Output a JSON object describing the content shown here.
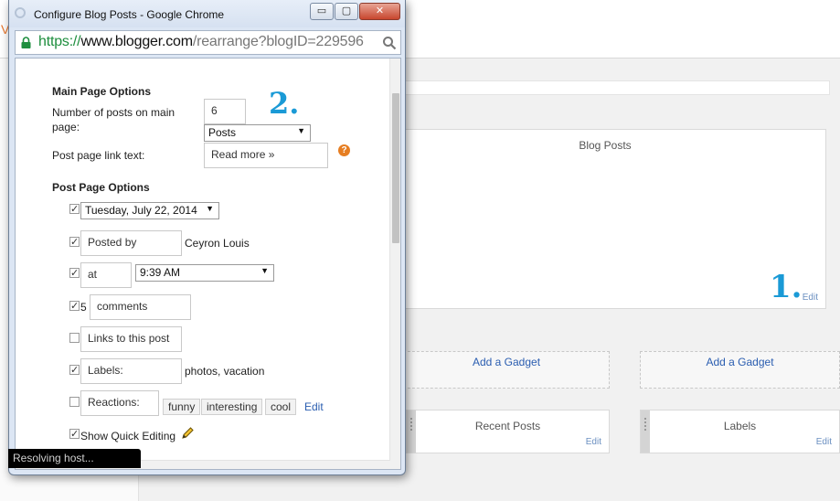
{
  "background": {
    "blog_posts_gadget": {
      "title": "Blog Posts",
      "edit": "Edit",
      "marker": "1."
    },
    "add_gadget_left": "Add a Gadget",
    "add_gadget_right": "Add a Gadget",
    "recent_posts_gadget": {
      "title": "Recent Posts",
      "edit": "Edit"
    },
    "labels_gadget": {
      "title": "Labels",
      "edit": "Edit"
    }
  },
  "window": {
    "title": "Configure Blog Posts - Google Chrome",
    "controls": {
      "minimize": "▭",
      "maximize": "▢",
      "close": "✕"
    },
    "url": {
      "scheme": "https://",
      "host": "www.blogger.com",
      "path": "/rearrange?blogID=229596"
    },
    "status": "Resolving host..."
  },
  "form": {
    "marker": "2.",
    "main_page": {
      "heading": "Main Page Options",
      "posts_label": "Number of posts on main page:",
      "posts_value": "6",
      "posts_unit": "Posts",
      "link_text_label": "Post page link text:",
      "link_text_value": "Read more »",
      "help": "?"
    },
    "post_page": {
      "heading": "Post Page Options",
      "date_option": {
        "checked": true,
        "value": "Tuesday, July 22, 2014"
      },
      "posted_by": {
        "checked": true,
        "field": "Posted by",
        "value": "Ceyron Louis"
      },
      "time": {
        "checked": true,
        "field": "at",
        "value": "9:39 AM"
      },
      "comments": {
        "checked": true,
        "count": "5",
        "field": "comments"
      },
      "links": {
        "checked": false,
        "field": "Links to this post"
      },
      "labels": {
        "checked": true,
        "field": "Labels:",
        "value": "photos, vacation"
      },
      "reactions": {
        "checked": false,
        "field": "Reactions:",
        "tags": [
          "funny",
          "interesting",
          "cool"
        ],
        "edit": "Edit"
      },
      "quick_edit": {
        "checked": true,
        "label": "Show Quick Editing"
      }
    }
  },
  "colors": {
    "accent_marker": "#1a9ad6",
    "link": "#2a5db0",
    "help_icon": "#e67e22",
    "url_scheme": "#1e8e3e"
  }
}
